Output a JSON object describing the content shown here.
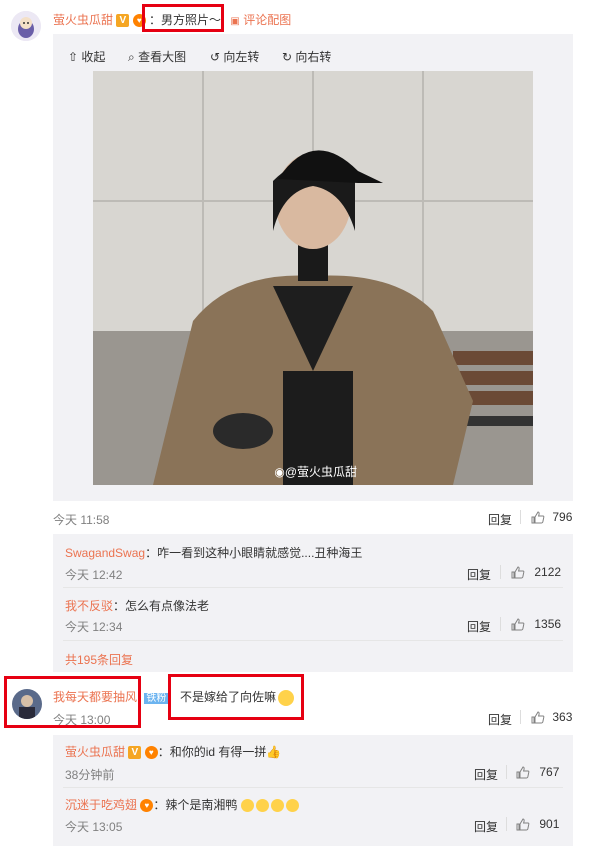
{
  "colors": {
    "name": "#eb7350",
    "gray": "#808080",
    "accent": "#e60012"
  },
  "main_comment": {
    "user": "萤火虫瓜甜",
    "text": "：男方照片～",
    "action": "评论配图",
    "toolbar": {
      "collapse": "收起",
      "view_large": "查看大图",
      "rotate_left": "向左转",
      "rotate_right": "向右转"
    },
    "watermark": "@萤火虫瓜甜",
    "time": "今天 11:58",
    "reply_label": "回复",
    "likes": "796"
  },
  "sub_replies": [
    {
      "user": "SwagandSwag",
      "text": "：咋一看到这种小眼睛就感觉....丑种海王",
      "time": "今天 12:42",
      "reply_label": "回复",
      "likes": "2122"
    },
    {
      "user": "我不反驳",
      "text": "：怎么有点像法老",
      "time": "今天 12:34",
      "reply_label": "回复",
      "likes": "1356"
    }
  ],
  "more_replies": "共195条回复",
  "second_comment": {
    "user": "我每天都要抽风",
    "badge": "铁粉",
    "text": "不是嫁给了向佐嘛",
    "time": "今天 13:00",
    "reply_label": "回复",
    "likes": "363"
  },
  "sub_replies_2": [
    {
      "user": "萤火虫瓜甜",
      "text": "：和你的id 有得一拼",
      "time": "38分钟前",
      "reply_label": "回复",
      "likes": "767"
    },
    {
      "user": "沉迷于吃鸡翅",
      "text": "：辣个是南湘鸭",
      "time": "今天 13:05",
      "reply_label": "回复",
      "likes": "901"
    }
  ]
}
